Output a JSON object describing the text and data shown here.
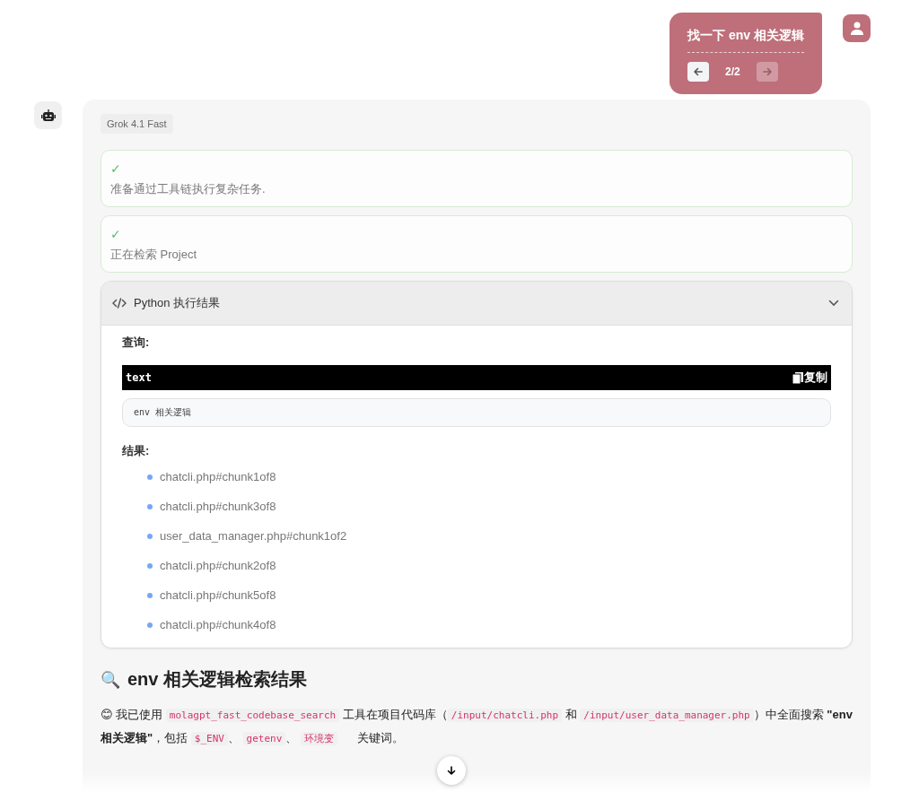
{
  "user_message": {
    "text": "找一下 env 相关逻辑",
    "pager": "2/2",
    "prev_disabled": false,
    "next_disabled": true
  },
  "assistant": {
    "model": "Grok 4.1 Fast",
    "steps": [
      {
        "done": true,
        "mark": "✓",
        "text": "准备通过工具链执行复杂任务."
      },
      {
        "done": true,
        "mark": "✓",
        "text": "正在检索 Project"
      }
    ],
    "tool_panel": {
      "title": "Python 执行结果",
      "expanded": true,
      "query_label": "查询:",
      "code_lang": "text",
      "copy_label": "复制",
      "code": "env 相关逻辑",
      "results_label": "结果:",
      "results": [
        "chatcli.php#chunk1of8",
        "chatcli.php#chunk3of8",
        "user_data_manager.php#chunk1of2",
        "chatcli.php#chunk2of8",
        "chatcli.php#chunk5of8",
        "chatcli.php#chunk4of8"
      ]
    },
    "heading_icon": "🔍",
    "heading": "env 相关逻辑检索结果",
    "paragraph": [
      {
        "kind": "text",
        "text": "😊 我已使用 "
      },
      {
        "kind": "code",
        "text": "molagpt_fast_codebase_search"
      },
      {
        "kind": "text",
        "text": " 工具在项目代码库（"
      },
      {
        "kind": "code",
        "text": "/input/chatcli.php"
      },
      {
        "kind": "text",
        "text": " 和 "
      },
      {
        "kind": "code",
        "text": "/input/user_data_manager.php"
      },
      {
        "kind": "text",
        "text": "）中全面搜索 "
      },
      {
        "kind": "bold",
        "text": "\"env 相关逻辑\""
      },
      {
        "kind": "text",
        "text": "，包括 "
      },
      {
        "kind": "code",
        "text": "$_ENV"
      },
      {
        "kind": "text",
        "text": "、 "
      },
      {
        "kind": "code",
        "text": "getenv"
      },
      {
        "kind": "text",
        "text": "、 "
      },
      {
        "kind": "code",
        "text": "环境变"
      },
      {
        "kind": "gap"
      },
      {
        "kind": "text",
        "text": "关键词。"
      }
    ]
  }
}
